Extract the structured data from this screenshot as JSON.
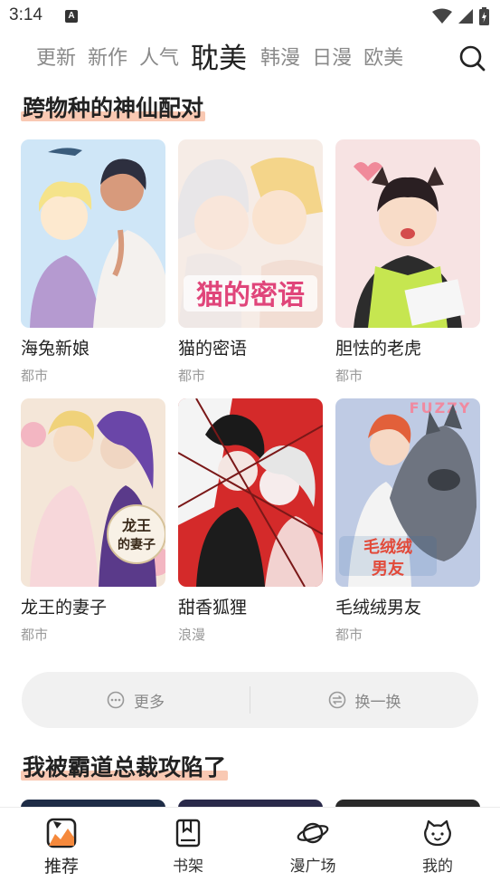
{
  "status": {
    "time": "3:14",
    "a_badge": "A"
  },
  "tabs": [
    {
      "label": "更新"
    },
    {
      "label": "新作"
    },
    {
      "label": "人气"
    },
    {
      "label": "耽美"
    },
    {
      "label": "韩漫"
    },
    {
      "label": "日漫"
    },
    {
      "label": "欧美"
    }
  ],
  "active_tab": "耽美",
  "section1": {
    "title": "跨物种的神仙配对",
    "comics": [
      {
        "title": "海兔新娘",
        "genre": "都市"
      },
      {
        "title": "猫的密语",
        "genre": "都市",
        "cover_text": "猫的密语"
      },
      {
        "title": "胆怯的老虎",
        "genre": "都市"
      },
      {
        "title": "龙王的妻子",
        "genre": "都市",
        "cover_text": "龙王的妻子"
      },
      {
        "title": "甜香狐狸",
        "genre": "浪漫"
      },
      {
        "title": "毛绒绒男友",
        "genre": "都市",
        "cover_text": "毛绒绒男友",
        "cover_top": "FUZZY"
      }
    ]
  },
  "actions": {
    "more": "更多",
    "refresh": "换一换"
  },
  "section2": {
    "title": "我被霸道总裁攻陷了"
  },
  "nav": [
    {
      "label": "推荐",
      "icon": "recommend-icon"
    },
    {
      "label": "书架",
      "icon": "bookshelf-icon"
    },
    {
      "label": "漫广场",
      "icon": "planet-icon"
    },
    {
      "label": "我的",
      "icon": "cat-face-icon"
    }
  ],
  "colors": {
    "accent": "#222222",
    "highlight": "#f9c9b3",
    "muted": "#8a8a8a"
  }
}
